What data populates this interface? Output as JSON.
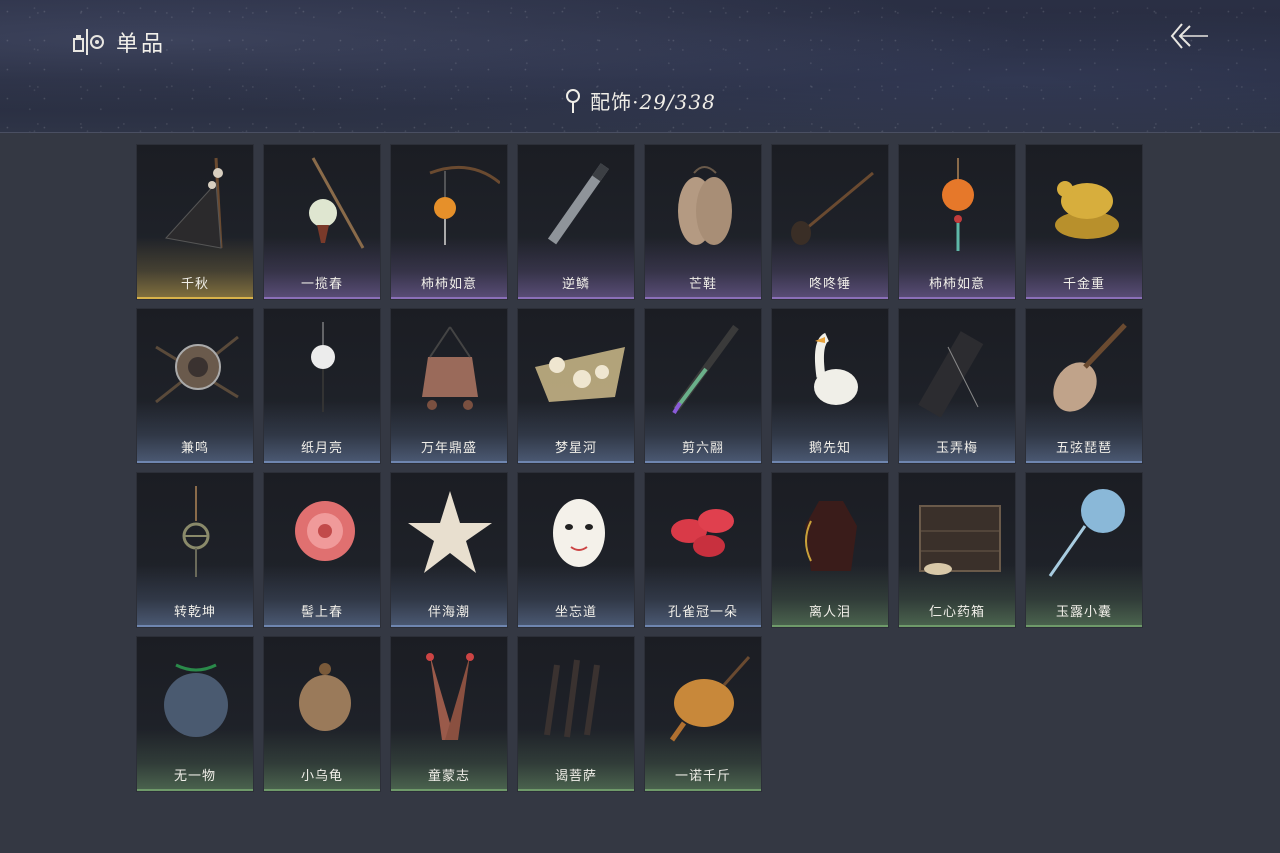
{
  "header": {
    "title": "单品",
    "subtitle_category": "配饰",
    "subtitle_sep": "·",
    "subtitle_count": "29/338"
  },
  "rarity_colors": {
    "gold": "#d8b24a",
    "purple": "#8a6fb8",
    "blue": "#6f86b0",
    "green": "#6f9a6a"
  },
  "items": [
    {
      "name": "千秋",
      "rarity": "gold",
      "icon": "hanging-flower-instrument-icon"
    },
    {
      "name": "一揽春",
      "rarity": "purple",
      "icon": "flower-basket-pole-icon"
    },
    {
      "name": "柿柿如意",
      "rarity": "purple",
      "icon": "persimmon-lantern-pole-icon"
    },
    {
      "name": "逆鳞",
      "rarity": "purple",
      "icon": "flute-weapon-icon"
    },
    {
      "name": "芒鞋",
      "rarity": "purple",
      "icon": "straw-sandals-icon"
    },
    {
      "name": "咚咚锤",
      "rarity": "purple",
      "icon": "drum-hammer-icon"
    },
    {
      "name": "柿柿如意",
      "rarity": "purple",
      "icon": "persimmon-pendant-icon"
    },
    {
      "name": "千金重",
      "rarity": "purple",
      "icon": "golden-bird-icon"
    },
    {
      "name": "兼鸣",
      "rarity": "blue",
      "icon": "bronze-disc-icon"
    },
    {
      "name": "纸月亮",
      "rarity": "blue",
      "icon": "paper-moon-icon"
    },
    {
      "name": "万年鼎盛",
      "rarity": "blue",
      "icon": "bronze-cauldron-icon"
    },
    {
      "name": "梦星河",
      "rarity": "blue",
      "icon": "flower-boat-icon"
    },
    {
      "name": "剪六翮",
      "rarity": "blue",
      "icon": "dagger-icon"
    },
    {
      "name": "鹅先知",
      "rarity": "blue",
      "icon": "goose-icon"
    },
    {
      "name": "玉弄梅",
      "rarity": "blue",
      "icon": "instrument-case-icon"
    },
    {
      "name": "五弦琵琶",
      "rarity": "blue",
      "icon": "pipa-icon"
    },
    {
      "name": "转乾坤",
      "rarity": "blue",
      "icon": "compass-pendant-icon"
    },
    {
      "name": "髻上春",
      "rarity": "blue",
      "icon": "peony-flower-icon"
    },
    {
      "name": "伴海潮",
      "rarity": "blue",
      "icon": "starfish-icon"
    },
    {
      "name": "坐忘道",
      "rarity": "blue",
      "icon": "white-mask-icon"
    },
    {
      "name": "孔雀冠一朵",
      "rarity": "blue",
      "icon": "red-flower-icon"
    },
    {
      "name": "离人泪",
      "rarity": "green",
      "icon": "wine-jar-icon"
    },
    {
      "name": "仁心药箱",
      "rarity": "green",
      "icon": "medicine-chest-icon"
    },
    {
      "name": "玉露小囊",
      "rarity": "green",
      "icon": "blue-pouch-icon"
    },
    {
      "name": "无一物",
      "rarity": "green",
      "icon": "cloth-bag-icon"
    },
    {
      "name": "小乌龟",
      "rarity": "green",
      "icon": "turtle-icon"
    },
    {
      "name": "童蒙志",
      "rarity": "green",
      "icon": "feather-quills-icon"
    },
    {
      "name": "谒菩萨",
      "rarity": "green",
      "icon": "vajra-bundle-icon"
    },
    {
      "name": "一诺千斤",
      "rarity": "green",
      "icon": "roast-chicken-icon"
    }
  ]
}
